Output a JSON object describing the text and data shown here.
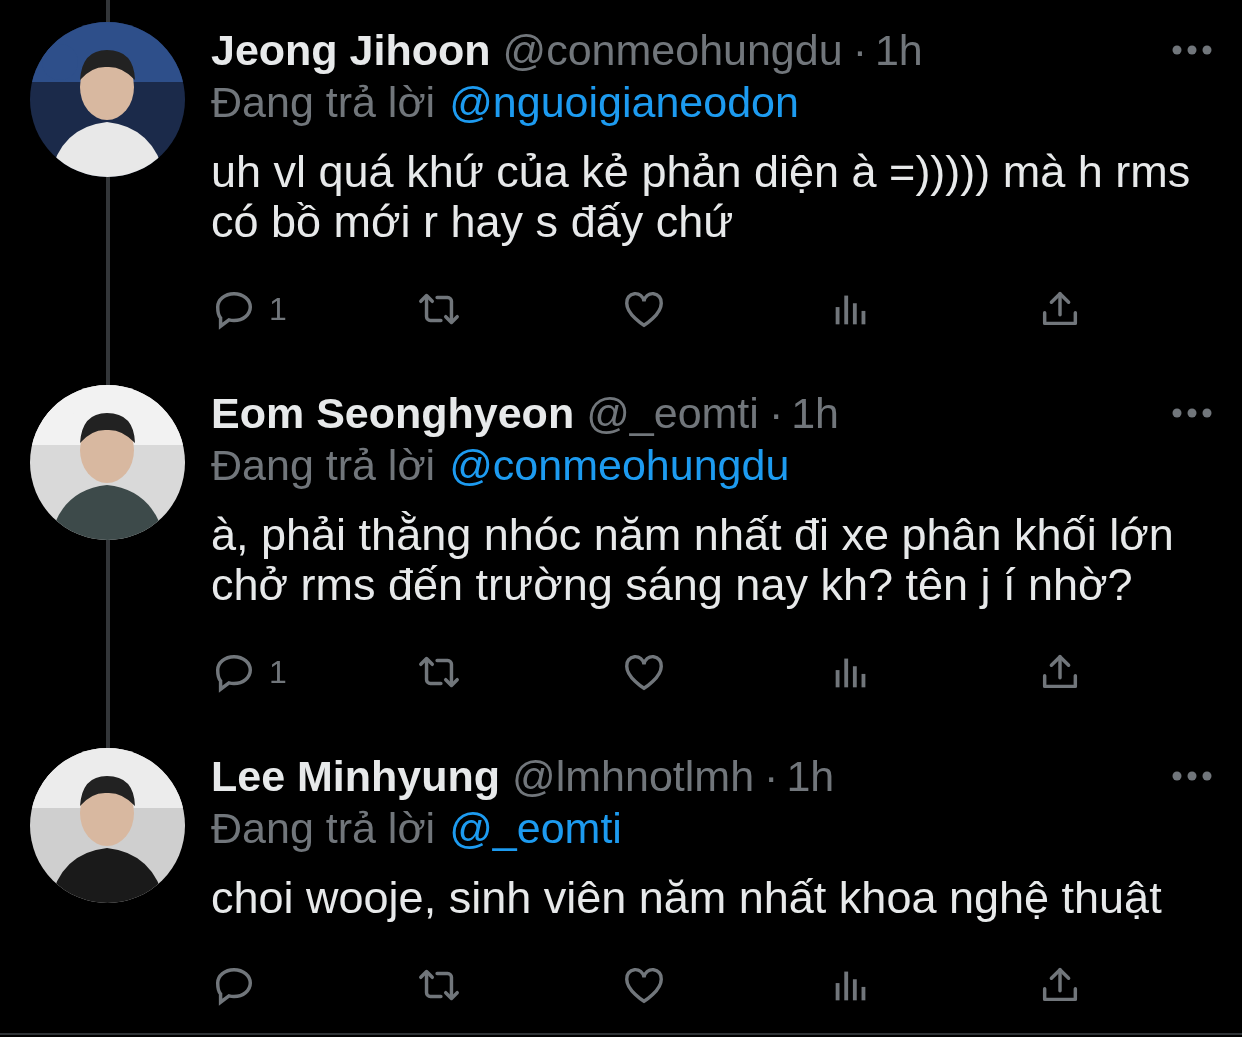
{
  "tweets": [
    {
      "name": "Jeong Jihoon",
      "handle": "@conmeohungdu",
      "separator": "·",
      "time": "1h",
      "reply_label": "Đang trả lời",
      "reply_to": "@nguoigianeodon",
      "text": "uh vl quá khứ của kẻ phản diện à =))))) mà h rms có bồ mới r hay s đấy chứ",
      "thread_line_above": true,
      "thread_line_below": true,
      "actions": [
        {
          "kind": "reply",
          "count": "1"
        },
        {
          "kind": "retweet"
        },
        {
          "kind": "like"
        },
        {
          "kind": "views"
        },
        {
          "kind": "share"
        }
      ]
    },
    {
      "name": "Eom Seonghyeon",
      "handle": "@_eomti",
      "separator": "·",
      "time": "1h",
      "reply_label": "Đang trả lời",
      "reply_to": "@conmeohungdu",
      "text": "à, phải thằng nhóc năm nhất đi xe phân khối lớn chở rms đến trường sáng nay kh? tên j í nhờ?",
      "thread_line_below": true,
      "actions": [
        {
          "kind": "reply",
          "count": "1"
        },
        {
          "kind": "retweet"
        },
        {
          "kind": "like"
        },
        {
          "kind": "views"
        },
        {
          "kind": "share"
        }
      ]
    },
    {
      "name": "Lee Minhyung",
      "handle": "@lmhnotlmh",
      "separator": "·",
      "time": "1h",
      "reply_label": "Đang trả lời",
      "reply_to": "@_eomti",
      "text": "choi wooje, sinh viên năm nhất khoa nghệ thuật",
      "thread_line_below": false,
      "actions": [
        {
          "kind": "reply"
        },
        {
          "kind": "retweet"
        },
        {
          "kind": "like"
        },
        {
          "kind": "views"
        },
        {
          "kind": "share"
        }
      ]
    }
  ]
}
